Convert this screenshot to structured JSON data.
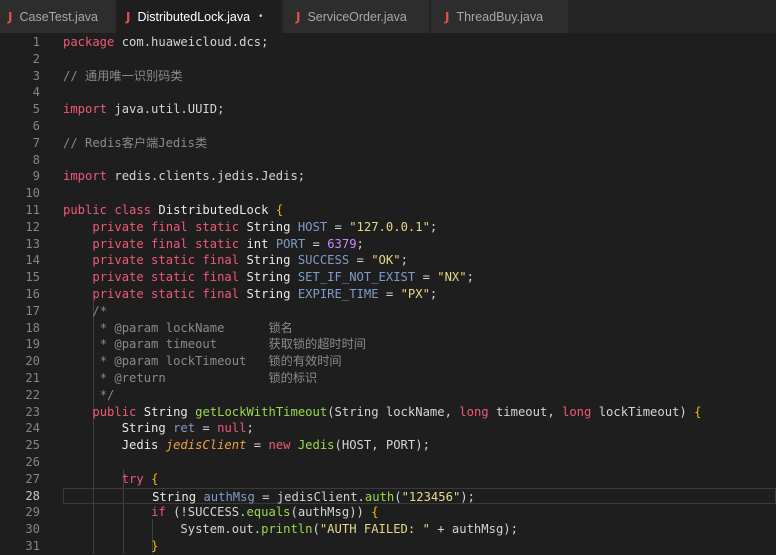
{
  "tabs": [
    {
      "label": "CaseTest.java",
      "active": false,
      "modified": false
    },
    {
      "label": "DistributedLock.java",
      "active": true,
      "modified": true
    },
    {
      "label": "ServiceOrder.java",
      "active": false,
      "modified": false
    },
    {
      "label": "ThreadBuy.java",
      "active": false,
      "modified": false
    }
  ],
  "tab_icon_glyph": "J",
  "modified_glyph": "•",
  "current_line": 28,
  "lines": [
    {
      "n": "1",
      "tokens": [
        [
          "k",
          "package"
        ],
        [
          "p",
          " com.huaweicloud.dcs;"
        ]
      ]
    },
    {
      "n": "2",
      "tokens": []
    },
    {
      "n": "3",
      "tokens": [
        [
          "c",
          "// 通用唯一识别码类"
        ]
      ]
    },
    {
      "n": "4",
      "tokens": []
    },
    {
      "n": "5",
      "tokens": [
        [
          "k",
          "import"
        ],
        [
          "p",
          " java.util.UUID;"
        ]
      ]
    },
    {
      "n": "6",
      "tokens": []
    },
    {
      "n": "7",
      "tokens": [
        [
          "c",
          "// Redis客户端Jedis类"
        ]
      ]
    },
    {
      "n": "8",
      "tokens": []
    },
    {
      "n": "9",
      "tokens": [
        [
          "k",
          "import"
        ],
        [
          "p",
          " redis.clients.jedis.Jedis;"
        ]
      ]
    },
    {
      "n": "10",
      "tokens": []
    },
    {
      "n": "11",
      "tokens": [
        [
          "k",
          "public class"
        ],
        [
          "p",
          " "
        ],
        [
          "cl",
          "DistributedLock"
        ],
        [
          "p",
          " "
        ],
        [
          "b",
          "{"
        ]
      ]
    },
    {
      "n": "12",
      "tokens": [
        [
          "p",
          "    "
        ],
        [
          "k",
          "private final static"
        ],
        [
          "p",
          " "
        ],
        [
          "t",
          "String"
        ],
        [
          "p",
          " "
        ],
        [
          "v",
          "HOST"
        ],
        [
          "p",
          " = "
        ],
        [
          "s",
          "\"127.0.0.1\""
        ],
        [
          "p",
          ";"
        ]
      ]
    },
    {
      "n": "13",
      "tokens": [
        [
          "p",
          "    "
        ],
        [
          "k",
          "private final static"
        ],
        [
          "p",
          " "
        ],
        [
          "t",
          "int"
        ],
        [
          "p",
          " "
        ],
        [
          "v",
          "PORT"
        ],
        [
          "p",
          " = "
        ],
        [
          "n",
          "6379"
        ],
        [
          "p",
          ";"
        ]
      ]
    },
    {
      "n": "14",
      "tokens": [
        [
          "p",
          "    "
        ],
        [
          "k",
          "private static final"
        ],
        [
          "p",
          " "
        ],
        [
          "t",
          "String"
        ],
        [
          "p",
          " "
        ],
        [
          "v",
          "SUCCESS"
        ],
        [
          "p",
          " = "
        ],
        [
          "s",
          "\"OK\""
        ],
        [
          "p",
          ";"
        ]
      ]
    },
    {
      "n": "15",
      "tokens": [
        [
          "p",
          "    "
        ],
        [
          "k",
          "private static final"
        ],
        [
          "p",
          " "
        ],
        [
          "t",
          "String"
        ],
        [
          "p",
          " "
        ],
        [
          "v",
          "SET_IF_NOT_EXIST"
        ],
        [
          "p",
          " = "
        ],
        [
          "s",
          "\"NX\""
        ],
        [
          "p",
          ";"
        ]
      ]
    },
    {
      "n": "16",
      "tokens": [
        [
          "p",
          "    "
        ],
        [
          "k",
          "private static final"
        ],
        [
          "p",
          " "
        ],
        [
          "t",
          "String"
        ],
        [
          "p",
          " "
        ],
        [
          "v",
          "EXPIRE_TIME"
        ],
        [
          "p",
          " = "
        ],
        [
          "s",
          "\"PX\""
        ],
        [
          "p",
          ";"
        ]
      ]
    },
    {
      "n": "17",
      "tokens": [
        [
          "p",
          "    "
        ],
        [
          "c",
          "/*"
        ]
      ]
    },
    {
      "n": "18",
      "tokens": [
        [
          "p",
          "    "
        ],
        [
          "c",
          " * @param lockName      锁名"
        ]
      ]
    },
    {
      "n": "19",
      "tokens": [
        [
          "p",
          "    "
        ],
        [
          "c",
          " * @param timeout       获取锁的超时时间"
        ]
      ]
    },
    {
      "n": "20",
      "tokens": [
        [
          "p",
          "    "
        ],
        [
          "c",
          " * @param lockTimeout   锁的有效时间"
        ]
      ]
    },
    {
      "n": "21",
      "tokens": [
        [
          "p",
          "    "
        ],
        [
          "c",
          " * @return              锁的标识"
        ]
      ]
    },
    {
      "n": "22",
      "tokens": [
        [
          "p",
          "    "
        ],
        [
          "c",
          " */"
        ]
      ]
    },
    {
      "n": "23",
      "tokens": [
        [
          "p",
          "    "
        ],
        [
          "k",
          "public"
        ],
        [
          "p",
          " "
        ],
        [
          "t",
          "String"
        ],
        [
          "p",
          " "
        ],
        [
          "f",
          "getLockWithTimeout"
        ],
        [
          "p",
          "(String lockName, "
        ],
        [
          "k",
          "long"
        ],
        [
          "p",
          " timeout, "
        ],
        [
          "k",
          "long"
        ],
        [
          "p",
          " lockTimeout) "
        ],
        [
          "b",
          "{"
        ]
      ]
    },
    {
      "n": "24",
      "tokens": [
        [
          "p",
          "        "
        ],
        [
          "t",
          "String"
        ],
        [
          "p",
          " "
        ],
        [
          "v",
          "ret"
        ],
        [
          "p",
          " = "
        ],
        [
          "k",
          "null"
        ],
        [
          "p",
          ";"
        ]
      ]
    },
    {
      "n": "25",
      "tokens": [
        [
          "p",
          "        "
        ],
        [
          "t",
          "Jedis"
        ],
        [
          "p",
          " "
        ],
        [
          "i",
          "jedisClient"
        ],
        [
          "p",
          " = "
        ],
        [
          "k",
          "new"
        ],
        [
          "p",
          " "
        ],
        [
          "f",
          "Jedis"
        ],
        [
          "p",
          "(HOST, PORT);"
        ]
      ]
    },
    {
      "n": "26",
      "tokens": []
    },
    {
      "n": "27",
      "tokens": [
        [
          "p",
          "        "
        ],
        [
          "k",
          "try"
        ],
        [
          "p",
          " "
        ],
        [
          "b",
          "{"
        ]
      ]
    },
    {
      "n": "28",
      "tokens": [
        [
          "p",
          "            "
        ],
        [
          "t",
          "String"
        ],
        [
          "p",
          " "
        ],
        [
          "v",
          "authMsg"
        ],
        [
          "p",
          " = jedisClient."
        ],
        [
          "f",
          "auth"
        ],
        [
          "p",
          "("
        ],
        [
          "s",
          "\"123456\""
        ],
        [
          "p",
          ");"
        ]
      ]
    },
    {
      "n": "29",
      "tokens": [
        [
          "p",
          "            "
        ],
        [
          "k",
          "if"
        ],
        [
          "p",
          " (!SUCCESS."
        ],
        [
          "f",
          "equals"
        ],
        [
          "p",
          "(authMsg)) "
        ],
        [
          "b",
          "{"
        ]
      ]
    },
    {
      "n": "30",
      "tokens": [
        [
          "p",
          "                System.out."
        ],
        [
          "f",
          "println"
        ],
        [
          "p",
          "("
        ],
        [
          "s",
          "\"AUTH FAILED: \""
        ],
        [
          "p",
          " + authMsg);"
        ]
      ]
    },
    {
      "n": "31",
      "tokens": [
        [
          "p",
          "            "
        ],
        [
          "b",
          "}"
        ]
      ]
    }
  ]
}
